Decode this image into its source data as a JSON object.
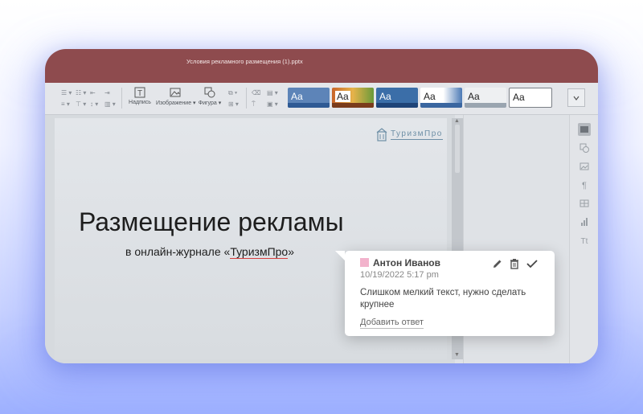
{
  "window": {
    "title": "Условия рекламного размещения (1).pptx"
  },
  "toolbar": {
    "textbox_label": "Надпись",
    "image_label": "Изображение",
    "shape_label": "Фигура",
    "themes": [
      {
        "label": "Aa"
      },
      {
        "label": "Aa"
      },
      {
        "label": "Aa"
      },
      {
        "label": "Aa"
      },
      {
        "label": "Aa"
      },
      {
        "label": "Aa"
      }
    ]
  },
  "slide": {
    "logo": "ТуризмПро",
    "title": "Размещение рекламы",
    "subtitle_prefix": "в онлайн-журнале «",
    "subtitle_link": "ТуризмПро",
    "subtitle_suffix": "»"
  },
  "comment": {
    "author": "Антон Иванов",
    "date": "10/19/2022 5:17 pm",
    "text": "Слишком мелкий текст, нужно сделать крупнее",
    "reply_label": "Добавить ответ",
    "author_color": "#f2b3cc"
  },
  "colors": {
    "titlebar": "#8e4b4e",
    "accent_logo": "#6e8fa6"
  }
}
